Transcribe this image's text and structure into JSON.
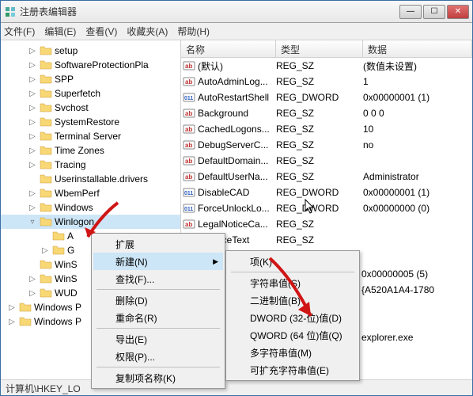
{
  "title": "注册表编辑器",
  "menubar": [
    "文件(F)",
    "编辑(E)",
    "查看(V)",
    "收藏夹(A)",
    "帮助(H)"
  ],
  "tree": [
    {
      "label": "setup",
      "lvl": 1,
      "exp": "▷"
    },
    {
      "label": "SoftwareProtectionPla",
      "lvl": 1,
      "exp": "▷"
    },
    {
      "label": "SPP",
      "lvl": 1,
      "exp": "▷"
    },
    {
      "label": "Superfetch",
      "lvl": 1,
      "exp": "▷"
    },
    {
      "label": "Svchost",
      "lvl": 1,
      "exp": "▷"
    },
    {
      "label": "SystemRestore",
      "lvl": 1,
      "exp": "▷"
    },
    {
      "label": "Terminal Server",
      "lvl": 1,
      "exp": "▷"
    },
    {
      "label": "Time Zones",
      "lvl": 1,
      "exp": "▷"
    },
    {
      "label": "Tracing",
      "lvl": 1,
      "exp": "▷"
    },
    {
      "label": "Userinstallable.drivers",
      "lvl": 1,
      "exp": ""
    },
    {
      "label": "WbemPerf",
      "lvl": 1,
      "exp": "▷"
    },
    {
      "label": "Windows",
      "lvl": 1,
      "exp": "▷"
    },
    {
      "label": "Winlogon",
      "lvl": 1,
      "exp": "▿",
      "sel": true
    },
    {
      "label": "A",
      "lvl": 2,
      "exp": ""
    },
    {
      "label": "G",
      "lvl": 2,
      "exp": "▷"
    },
    {
      "label": "WinS",
      "lvl": 1,
      "exp": ""
    },
    {
      "label": "WinS",
      "lvl": 1,
      "exp": "▷"
    },
    {
      "label": "WUD",
      "lvl": 1,
      "exp": "▷"
    },
    {
      "label": "Windows P",
      "lvl": 0,
      "exp": "▷"
    },
    {
      "label": "Windows P",
      "lvl": 0,
      "exp": "▷"
    }
  ],
  "columns": {
    "name": "名称",
    "type": "类型",
    "data": "数据"
  },
  "rows": [
    {
      "ic": "str",
      "name": "(默认)",
      "type": "REG_SZ",
      "data": "(数值未设置)"
    },
    {
      "ic": "str",
      "name": "AutoAdminLog...",
      "type": "REG_SZ",
      "data": "1"
    },
    {
      "ic": "bin",
      "name": "AutoRestartShell",
      "type": "REG_DWORD",
      "data": "0x00000001 (1)"
    },
    {
      "ic": "str",
      "name": "Background",
      "type": "REG_SZ",
      "data": "0 0 0"
    },
    {
      "ic": "str",
      "name": "CachedLogons...",
      "type": "REG_SZ",
      "data": "10"
    },
    {
      "ic": "str",
      "name": "DebugServerC...",
      "type": "REG_SZ",
      "data": "no"
    },
    {
      "ic": "str",
      "name": "DefaultDomain...",
      "type": "REG_SZ",
      "data": ""
    },
    {
      "ic": "str",
      "name": "DefaultUserNa...",
      "type": "REG_SZ",
      "data": "Administrator"
    },
    {
      "ic": "bin",
      "name": "DisableCAD",
      "type": "REG_DWORD",
      "data": "0x00000001 (1)"
    },
    {
      "ic": "bin",
      "name": "ForceUnlockLo...",
      "type": "REG_DWORD",
      "data": "0x00000000 (0)"
    },
    {
      "ic": "str",
      "name": "LegalNoticeCa...",
      "type": "REG_SZ",
      "data": ""
    },
    {
      "ic": "str",
      "name": "alNoticeText",
      "type": "REG_SZ",
      "data": ""
    }
  ],
  "extra_rows": [
    {
      "data": "0x00000005 (5)"
    },
    {
      "data": "{A520A1A4-1780"
    },
    {
      "data": ""
    },
    {
      "data": ""
    },
    {
      "data": "explorer.exe"
    }
  ],
  "ctx1": {
    "items": [
      {
        "label": "扩展"
      },
      {
        "label": "新建(N)",
        "arrow": true,
        "hl": true
      },
      {
        "label": "查找(F)..."
      }
    ],
    "group2": [
      {
        "label": "删除(D)"
      },
      {
        "label": "重命名(R)"
      }
    ],
    "group3": [
      {
        "label": "导出(E)"
      },
      {
        "label": "权限(P)..."
      }
    ],
    "group4": [
      {
        "label": "复制项名称(K)"
      }
    ]
  },
  "ctx2": [
    {
      "label": "项(K)"
    },
    {
      "sep": true
    },
    {
      "label": "字符串值(S)"
    },
    {
      "label": "二进制值(B)"
    },
    {
      "label": "DWORD (32-位)值(D)"
    },
    {
      "label": "QWORD (64 位)值(Q)"
    },
    {
      "label": "多字符串值(M)"
    },
    {
      "label": "可扩充字符串值(E)"
    }
  ],
  "status": "计算机\\HKEY_LO",
  "cursor_label": "REG_DWORD"
}
